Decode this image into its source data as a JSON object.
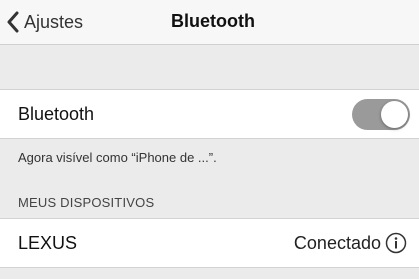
{
  "navbar": {
    "back_label": "Ajustes",
    "title": "Bluetooth",
    "back_icon": "chevron-left-icon"
  },
  "bluetooth_row": {
    "label": "Bluetooth",
    "toggle_on": true
  },
  "visibility_note": "Agora visível como “iPhone de ...”.",
  "devices_section": {
    "header": "MEUS DISPOSITIVOS",
    "devices": [
      {
        "name": "LEXUS",
        "status": "Conectado",
        "icon": "info-icon"
      }
    ]
  }
}
